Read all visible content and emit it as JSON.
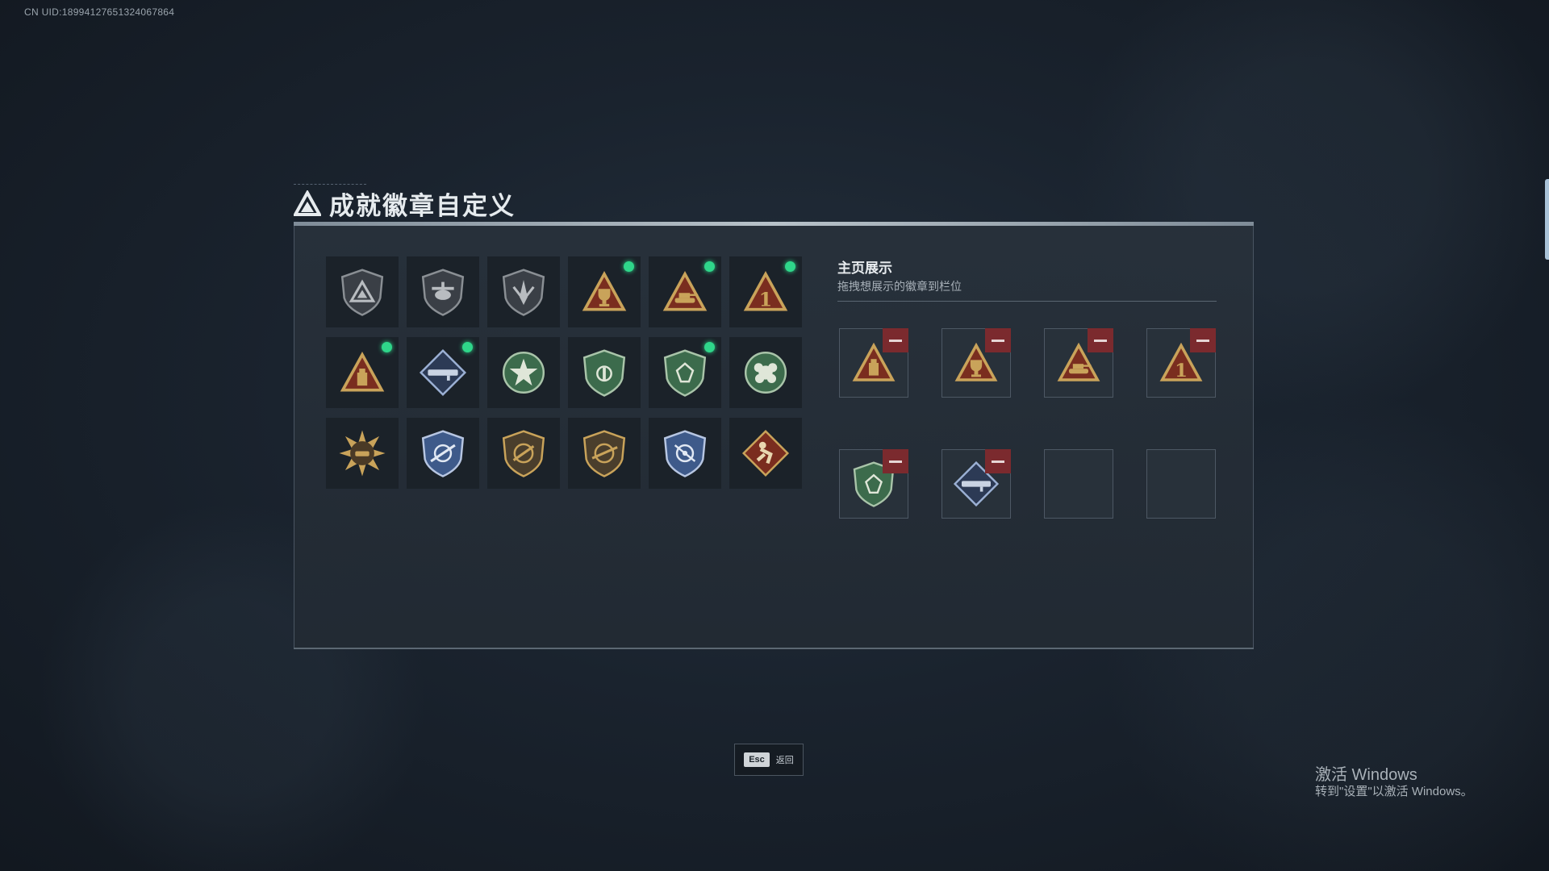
{
  "uid": "CN UID:1899412765132406​7864",
  "header": {
    "title": "成就徽章自定义"
  },
  "badges": [
    {
      "icon": "triangle-emblem-shield-icon",
      "new": false
    },
    {
      "icon": "helicopter-shield-icon",
      "new": false
    },
    {
      "icon": "blade-shield-icon",
      "new": false
    },
    {
      "icon": "trophy-triangle-icon",
      "new": true
    },
    {
      "icon": "tank-triangle-icon",
      "new": true
    },
    {
      "icon": "number-one-triangle-icon",
      "new": true
    },
    {
      "icon": "ammo-triangle-icon",
      "new": true
    },
    {
      "icon": "rocket-launcher-diamond-icon",
      "new": true
    },
    {
      "icon": "star-wreath-icon",
      "new": false
    },
    {
      "icon": "green-beret-shield-icon",
      "new": false
    },
    {
      "icon": "green-gem-shield-icon",
      "new": true
    },
    {
      "icon": "green-flower-medal-icon",
      "new": false
    },
    {
      "icon": "explosion-tank-icon",
      "new": false
    },
    {
      "icon": "blue-sniper-shield-icon",
      "new": false
    },
    {
      "icon": "gold-rifle-shield-icon",
      "new": false
    },
    {
      "icon": "gold-sniper-shield-icon",
      "new": false
    },
    {
      "icon": "blue-target-shield-icon",
      "new": false
    },
    {
      "icon": "soldier-diamond-icon",
      "new": false
    }
  ],
  "showcase": {
    "title": "主页展示",
    "subtitle": "拖拽想展示的徽章到栏位",
    "slots": [
      {
        "icon": "ammo-triangle-icon",
        "filled": true
      },
      {
        "icon": "trophy-triangle-icon",
        "filled": true
      },
      {
        "icon": "tank-triangle-icon",
        "filled": true
      },
      {
        "icon": "number-one-triangle-icon",
        "filled": true
      },
      {
        "icon": "green-gem-shield-icon",
        "filled": true
      },
      {
        "icon": "rocket-launcher-diamond-icon",
        "filled": true
      },
      {
        "icon": "",
        "filled": false
      },
      {
        "icon": "",
        "filled": false
      }
    ]
  },
  "footer": {
    "esc_key": "Esc",
    "esc_label": "返回"
  },
  "watermark": {
    "line1": "激活 Windows",
    "line2": "转到\"设置\"以激活 Windows。"
  },
  "colors": {
    "new_dot": "#2fd68a",
    "remove_button": "#7b2a2e",
    "gold": "#c9a35a",
    "bronze_red": "#7a2d1f",
    "green": "#3c6b4c",
    "blue": "#3e5a8a"
  }
}
